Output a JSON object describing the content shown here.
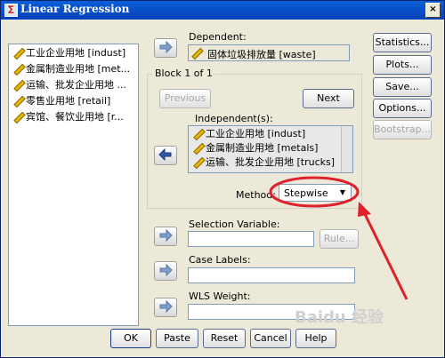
{
  "window": {
    "title": "Linear Regression",
    "close_label": "×"
  },
  "variable_list": [
    "工业企业用地 [indust]",
    "金属制造业用地 [met...",
    "运输、批发企业用地 ...",
    "零售业用地 [retail]",
    "宾馆、餐饮业用地 [r..."
  ],
  "dependent": {
    "label": "Dependent:",
    "value": "固体垃圾排放量 [waste]"
  },
  "block": {
    "label": "Block 1 of 1",
    "previous_label": "Previous",
    "next_label": "Next",
    "independent_label": "Independent(s):",
    "independents": [
      "工业企业用地 [indust]",
      "金属制造业用地 [metals]",
      "运输、批发企业用地 [trucks]"
    ],
    "method_label": "Method:",
    "method_value": "Stepwise"
  },
  "selection": {
    "label": "Selection Variable:",
    "rule_label": "Rule..."
  },
  "case_labels": {
    "label": "Case Labels:"
  },
  "wls": {
    "label": "WLS Weight:"
  },
  "side_buttons": {
    "statistics": "Statistics...",
    "plots": "Plots...",
    "save": "Save...",
    "options": "Options...",
    "bootstrap": "Bootstrap..."
  },
  "bottom_buttons": {
    "ok": "OK",
    "paste": "Paste",
    "reset": "Reset",
    "cancel": "Cancel",
    "help": "Help"
  },
  "watermark": "Baidu 经验",
  "colors": {
    "annotation": "#e0202a",
    "title_bar": "#0a5fd8"
  }
}
